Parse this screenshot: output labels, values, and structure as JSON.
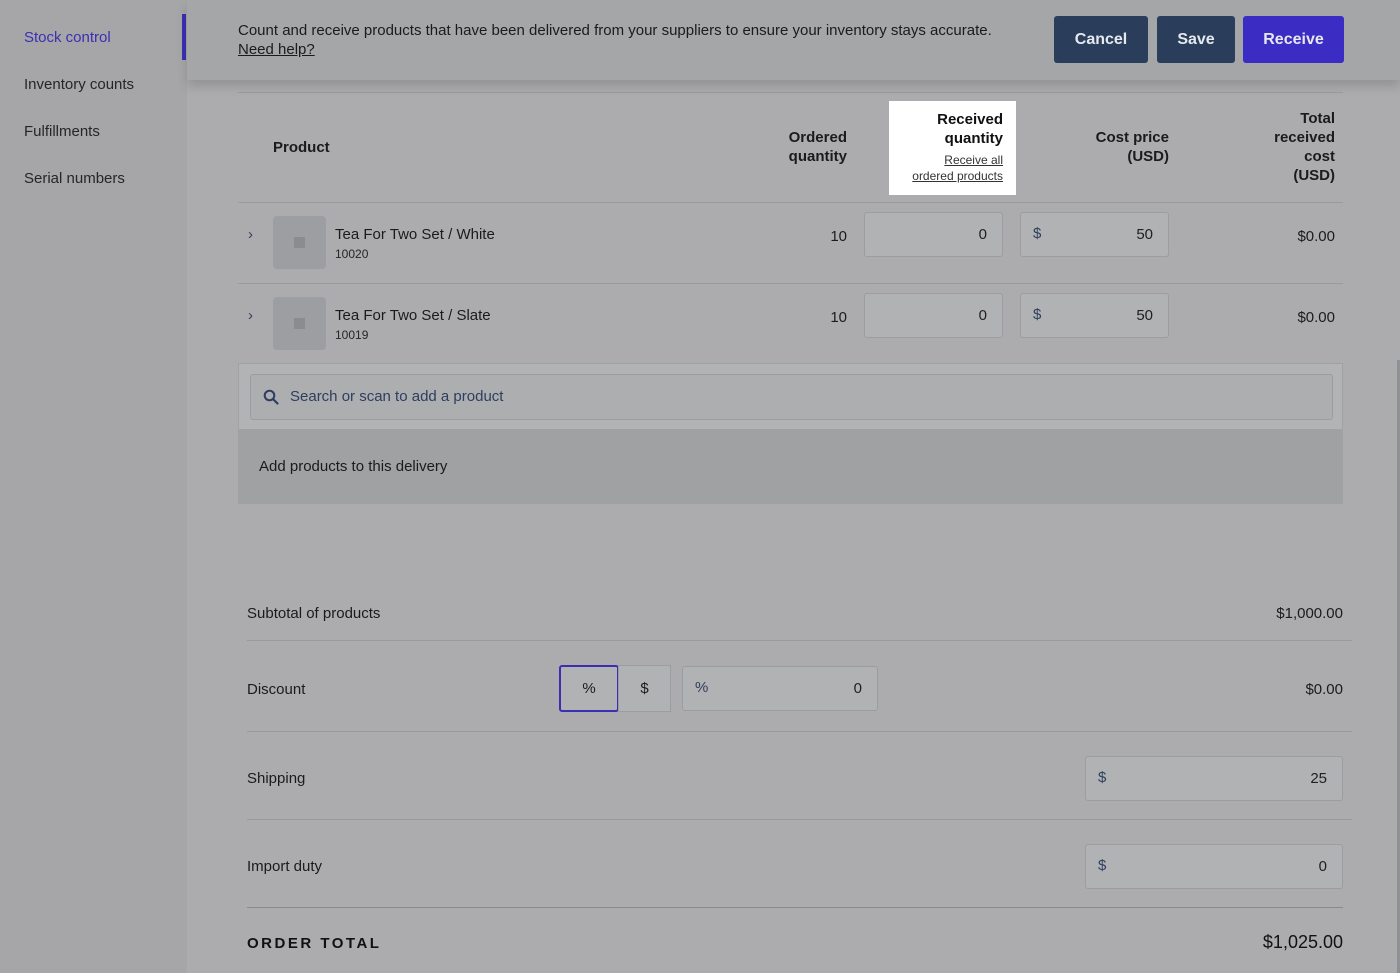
{
  "sidebar": {
    "items": [
      {
        "label": "Stock control"
      },
      {
        "label": "Inventory counts"
      },
      {
        "label": "Fulfillments"
      },
      {
        "label": "Serial numbers"
      }
    ]
  },
  "header": {
    "description": "Count and receive products that have been delivered from your suppliers to ensure your inventory stays accurate.",
    "help_link": "Need help?",
    "cancel_label": "Cancel",
    "save_label": "Save",
    "receive_label": "Receive"
  },
  "table": {
    "col_product": "Product",
    "col_ordered_line1": "Ordered",
    "col_ordered_line2": "quantity",
    "col_received_line1": "Received",
    "col_received_line2": "quantity",
    "receive_all_line1": "Receive all",
    "receive_all_line2": "ordered products",
    "col_cost_line1": "Cost price",
    "col_cost_line2": "(USD)",
    "col_total_line1": "Total",
    "col_total_line2": "received",
    "col_total_line3": "cost",
    "col_total_line4": "(USD)",
    "rows": [
      {
        "name": "Tea For Two Set / White",
        "sku": "10020",
        "ordered": "10",
        "received": "0",
        "currency": "$",
        "cost": "50",
        "total": "$0.00"
      },
      {
        "name": "Tea For Two Set / Slate",
        "sku": "10019",
        "ordered": "10",
        "received": "0",
        "currency": "$",
        "cost": "50",
        "total": "$0.00"
      }
    ]
  },
  "search": {
    "placeholder": "Search or scan to add a product",
    "add_text": "Add products to this delivery"
  },
  "totals": {
    "subtotal_label": "Subtotal of products",
    "subtotal_value": "$1,000.00",
    "discount_label": "Discount",
    "discount_percent_toggle": "%",
    "discount_dollar_toggle": "$",
    "discount_prefix": "%",
    "discount_value": "0",
    "discount_amount": "$0.00",
    "shipping_label": "Shipping",
    "shipping_prefix": "$",
    "shipping_value": "25",
    "import_label": "Import duty",
    "import_prefix": "$",
    "import_value": "0",
    "order_total_label": "ORDER TOTAL",
    "order_total_value": "$1,025.00"
  },
  "colors": {
    "accent": "#3a2fb3",
    "button_dark": "#2a3e5c",
    "button_primary": "#3b2dc4"
  }
}
